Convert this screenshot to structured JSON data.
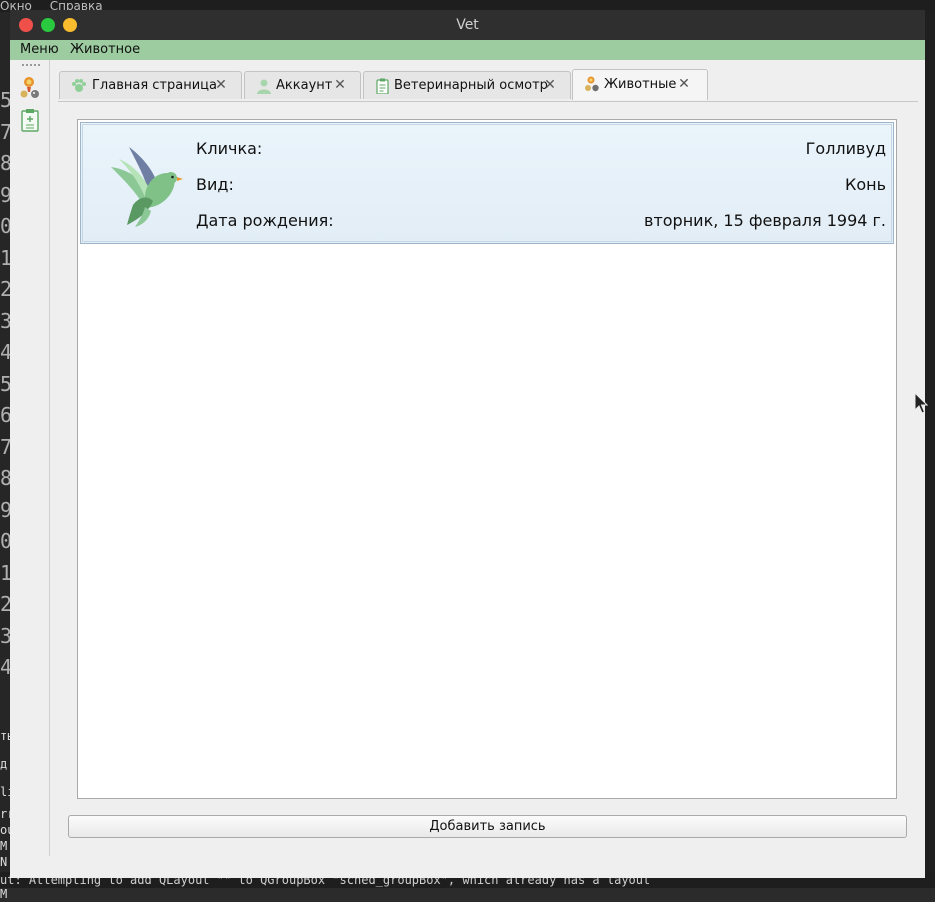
{
  "background": {
    "top_menu": [
      "Окно",
      "Справка"
    ],
    "line_numbers": [
      "5",
      "7",
      "8",
      "9",
      "0",
      "1",
      "2",
      "3",
      "4",
      "5",
      "6",
      "7",
      "8",
      "9",
      "0",
      "1",
      "2",
      "3",
      "4"
    ],
    "side_fragments": [
      "ты",
      "д",
      "lie",
      "rr",
      "ou",
      "M",
      "N",
      "N",
      "M"
    ],
    "bottom_text": "ut: Attempting to add QLayout \"\" to QGroupBox \"sched_groupBox\", which already has a layout"
  },
  "window": {
    "title": "Vet"
  },
  "menubar": {
    "items": [
      "Меню",
      "Животное"
    ]
  },
  "toolbar": {
    "icons": [
      "pets-icon",
      "clipboard-add-icon"
    ]
  },
  "tabs": [
    {
      "label": "Главная страница",
      "icon": "paw-icon",
      "active": false
    },
    {
      "label": "Аккаунт",
      "icon": "user-icon",
      "active": false
    },
    {
      "label": "Ветеринарный осмотр",
      "icon": "clipboard-icon",
      "active": false
    },
    {
      "label": "Животные",
      "icon": "pets-icon",
      "active": true
    }
  ],
  "animal_card": {
    "image": "bird-icon",
    "name_label": "Кличка:",
    "name_value": "Голливуд",
    "species_label": "Вид:",
    "species_value": "Конь",
    "birth_label": "Дата рождения:",
    "birth_value": "вторник, 15 февраля 1994 г."
  },
  "add_button": {
    "label": "Добавить запись"
  },
  "colors": {
    "menubar": "#9ccc9f",
    "card_bg": "#e6f1f9",
    "card_border": "#9fb4c6"
  }
}
